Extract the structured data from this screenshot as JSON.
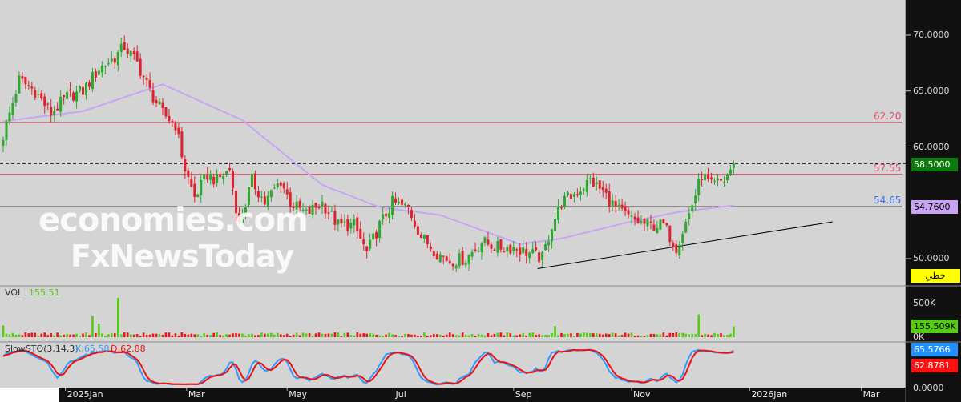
{
  "colors": {
    "bg": "#d4d4d4",
    "axis_bg": "#111111",
    "up": "#2ea82e",
    "down": "#e0202e",
    "ma": "#c9a4f5",
    "k": "#2f9bff",
    "d": "#ee1111",
    "vol_up": "#55cc11",
    "vol_down": "#ee1111"
  },
  "watermark": {
    "line1": "economies.com",
    "line2": "FxNewsToday"
  },
  "levels": [
    {
      "value": 62.2,
      "label": "62.20",
      "color": "#e0506a"
    },
    {
      "value": 57.55,
      "label": "57.55",
      "color": "#e0506a"
    },
    {
      "value": 54.65,
      "label": "54.65",
      "color": "#3b6fe8"
    }
  ],
  "price_tags": {
    "last": "58.5000",
    "ma": "54.7600",
    "mode": "خطي",
    "volume": "155.509K",
    "k": "65.5766",
    "d": "62.8781"
  },
  "volume_panel": {
    "title": "VOL",
    "value": "155.51",
    "ticks": [
      "500K",
      "0K"
    ]
  },
  "sto_panel": {
    "title": "SlowSTO(3,14,3)",
    "k_label": "K:65.58",
    "d_label": "D:62.88",
    "ticks": [
      "0.0000"
    ]
  },
  "chart_data": {
    "type": "candlestick",
    "ylim": [
      47,
      73.5
    ],
    "y_ticks": [
      "50.0000",
      "60.0000",
      "65.0000",
      "70.0000"
    ],
    "y_tick_values": [
      50,
      60,
      65,
      70
    ],
    "x_ticks": [
      {
        "label": "2025Jan",
        "index": 19.5
      },
      {
        "label": "Mar",
        "index": 57.5
      },
      {
        "label": "May",
        "index": 89
      },
      {
        "label": "Jul",
        "index": 122.5
      },
      {
        "label": "Sep",
        "index": 160
      },
      {
        "label": "Nov",
        "index": 197
      },
      {
        "label": "2026Jan",
        "index": 234
      },
      {
        "label": "Mar",
        "index": 269
      }
    ],
    "candle_count": 230,
    "close_keypoints": [
      [
        0,
        61
      ],
      [
        5,
        66
      ],
      [
        10,
        65
      ],
      [
        15,
        63
      ],
      [
        20,
        64.5
      ],
      [
        25,
        65
      ],
      [
        30,
        67
      ],
      [
        35,
        68
      ],
      [
        38,
        69
      ],
      [
        42,
        67.5
      ],
      [
        46,
        65
      ],
      [
        50,
        63
      ],
      [
        54,
        62
      ],
      [
        57,
        58
      ],
      [
        60,
        55.5
      ],
      [
        64,
        57.5
      ],
      [
        67,
        57
      ],
      [
        71,
        58
      ],
      [
        74,
        53
      ],
      [
        78,
        57
      ],
      [
        82,
        55
      ],
      [
        87,
        57
      ],
      [
        90,
        55
      ],
      [
        95,
        54
      ],
      [
        100,
        55
      ],
      [
        105,
        53
      ],
      [
        110,
        53
      ],
      [
        114,
        50.5
      ],
      [
        118,
        53
      ],
      [
        122,
        55
      ],
      [
        127,
        54.5
      ],
      [
        131,
        52
      ],
      [
        136,
        50.5
      ],
      [
        140,
        49.8
      ],
      [
        145,
        50
      ],
      [
        150,
        51.5
      ],
      [
        155,
        51
      ],
      [
        160,
        51
      ],
      [
        165,
        50.5
      ],
      [
        169,
        50
      ],
      [
        172,
        53
      ],
      [
        175,
        55
      ],
      [
        180,
        56
      ],
      [
        184,
        57
      ],
      [
        188,
        56
      ],
      [
        192,
        54.5
      ],
      [
        197,
        53.5
      ],
      [
        202,
        53
      ],
      [
        207,
        53
      ],
      [
        211,
        51
      ],
      [
        215,
        54
      ],
      [
        219,
        57.5
      ],
      [
        222,
        56.5
      ],
      [
        226,
        57
      ],
      [
        229,
        58.5
      ]
    ],
    "ma_keypoints": [
      [
        0,
        62.3
      ],
      [
        25,
        63.2
      ],
      [
        50,
        65.6
      ],
      [
        75,
        62.4
      ],
      [
        100,
        56.6
      ],
      [
        118,
        54.6
      ],
      [
        137,
        53.9
      ],
      [
        162,
        51.3
      ],
      [
        175,
        51.8
      ],
      [
        195,
        53.2
      ],
      [
        212,
        54.2
      ],
      [
        229,
        54.76
      ]
    ],
    "trendline": [
      [
        167.5,
        49.1
      ],
      [
        260,
        53.3
      ]
    ],
    "volume_max": 650000,
    "volume_spikes": [
      [
        0,
        170000
      ],
      [
        28,
        310000
      ],
      [
        30,
        200000
      ],
      [
        36,
        570000
      ],
      [
        173,
        160000
      ],
      [
        218,
        330000
      ],
      [
        229,
        155509
      ]
    ]
  }
}
